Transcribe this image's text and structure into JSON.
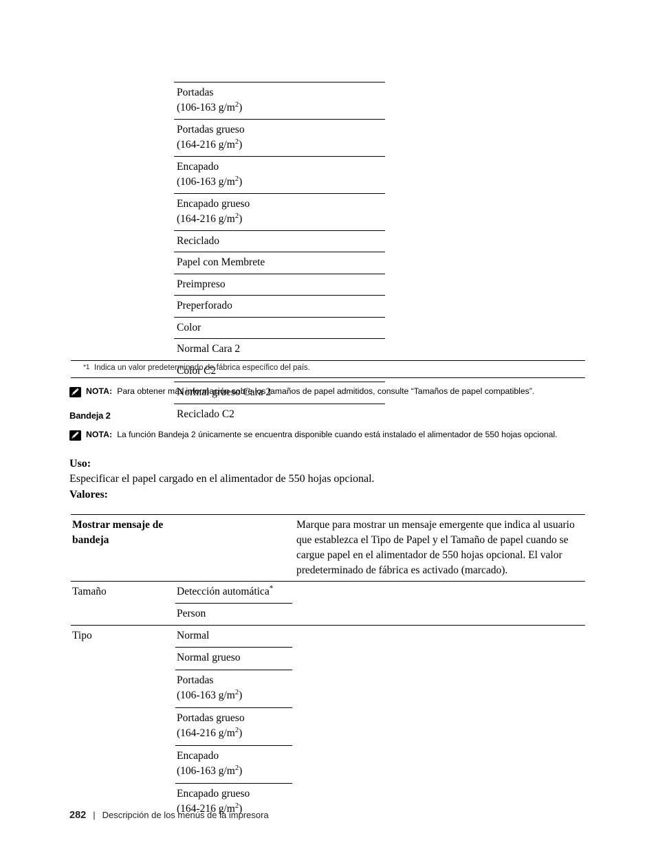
{
  "table1": {
    "rows": [
      {
        "line1": "Portadas",
        "line2": "(106-163 g/m",
        "sup": "2",
        "line2_end": ")"
      },
      {
        "line1": "Portadas grueso",
        "line2": "(164-216 g/m",
        "sup": "2",
        "line2_end": ")"
      },
      {
        "line1": "Encapado",
        "line2": "(106-163 g/m",
        "sup": "2",
        "line2_end": ")"
      },
      {
        "line1": "Encapado grueso",
        "line2": "(164-216 g/m",
        "sup": "2",
        "line2_end": ")"
      },
      {
        "line1": "Reciclado"
      },
      {
        "line1": "Papel con Membrete"
      },
      {
        "line1": "Preimpreso"
      },
      {
        "line1": "Preperforado"
      },
      {
        "line1": "Color"
      },
      {
        "line1": "Normal Cara 2"
      },
      {
        "line1": "Color C2"
      },
      {
        "line1": "Normal grueso Cara 2"
      },
      {
        "line1": "Reciclado C2"
      }
    ]
  },
  "footnote": {
    "marker": "*1",
    "text": "Indica un valor predeterminado de fábrica específico del país."
  },
  "note1": {
    "icon": "pencil-note-icon",
    "label": "NOTA:",
    "text": "Para obtener más información sobre los tamaños de papel admitidos, consulte “Tamaños de papel compatibles”."
  },
  "heading": {
    "text": "Bandeja 2"
  },
  "note2": {
    "icon": "pencil-note-icon",
    "label": "NOTA:",
    "text": "La función Bandeja 2 únicamente se encuentra disponible cuando está instalado el alimentador de 550 hojas opcional."
  },
  "uso": {
    "label": "Uso:",
    "text": "Especificar el papel cargado en el alimentador de 550 hojas opcional."
  },
  "valores": {
    "label": "Valores:"
  },
  "table2": {
    "row_mostrar": {
      "label_line1": "Mostrar mensaje de",
      "label_line2": "bandeja",
      "description": "Marque para mostrar un mensaje emergente que indica al usuario que establezca el Tipo de Papel y el Tamaño de papel cuando se cargue papel en el alimentador de 550 hojas opcional. El valor predeterminado de fábrica es activado (marcado)."
    },
    "row_tamano": {
      "label": "Tamaño",
      "value": "Detección automática",
      "value_sup": "*"
    },
    "row_person": {
      "value": "Person"
    },
    "row_tipo": {
      "label": "Tipo",
      "value": "Normal"
    },
    "tipo_values": [
      {
        "line1": "Normal grueso"
      },
      {
        "line1": "Portadas",
        "line2": "(106-163 g/m",
        "sup": "2",
        "line2_end": ")"
      },
      {
        "line1": "Portadas grueso",
        "line2": "(164-216 g/m",
        "sup": "2",
        "line2_end": ")"
      },
      {
        "line1": "Encapado",
        "line2": "(106-163 g/m",
        "sup": "2",
        "line2_end": ")"
      },
      {
        "line1": "Encapado grueso",
        "line2": "(164-216 g/m",
        "sup": "2",
        "line2_end": ")"
      }
    ]
  },
  "footer": {
    "page_number": "282",
    "divider": "|",
    "title": "Descripción de los menús de la impresora"
  }
}
